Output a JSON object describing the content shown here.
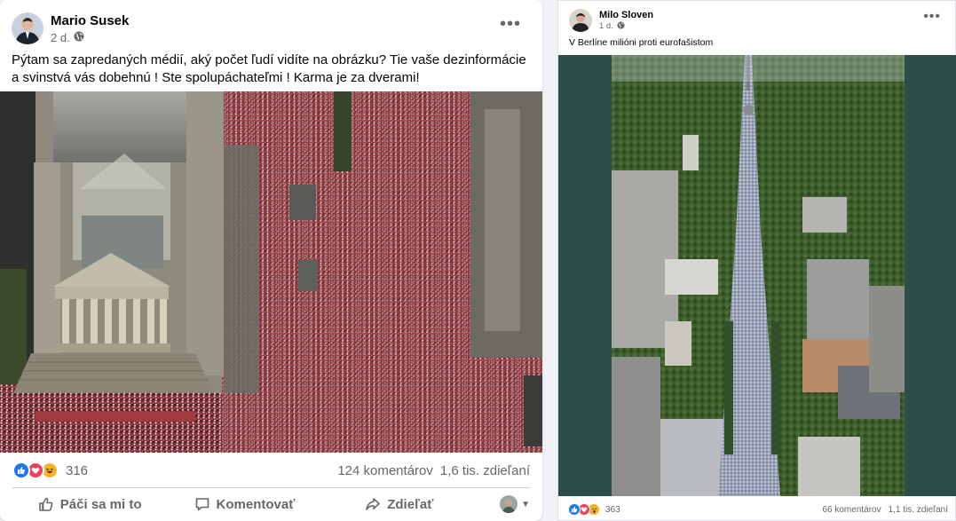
{
  "post1": {
    "author": "Mario Susek",
    "time": "2 d.",
    "caption": "Pýtam sa zapredaných médií, aký počet ľudí vidíte na obrázku? Tie vaše dezinformácie a svinstvá vás dobehnú ! Ste spolupáchateľmi ! Karma je za dverami!",
    "reaction_count": "316",
    "comments": "124 komentárov",
    "shares": "1,6 tis. zdieľaní",
    "actions": {
      "like": "Páči sa mi to",
      "comment": "Komentovať",
      "share": "Zdieľať"
    },
    "reaction_icons": [
      "like-icon",
      "love-icon",
      "haha-icon"
    ]
  },
  "post2": {
    "author": "Milo Sloven",
    "time": "1 d.",
    "caption": "V Berlíne milióni proti eurofašistom",
    "reaction_count": "363",
    "comments": "66 komentárov",
    "shares": "1,1 tis. zdieľaní",
    "reaction_icons": [
      "like-icon",
      "love-icon",
      "wow-icon"
    ]
  },
  "colors": {
    "brand_blue": "#1877f2",
    "love_red": "#f33e58",
    "haha_yellow": "#f7b125",
    "meta_gray": "#65676b"
  }
}
